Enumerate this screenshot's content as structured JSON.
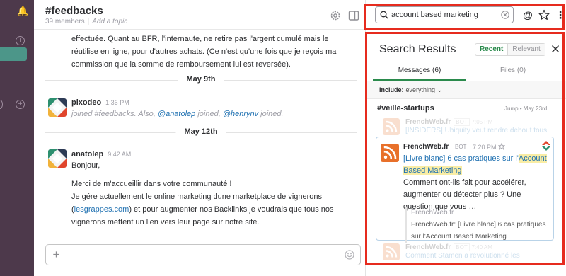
{
  "channel": {
    "name": "#feedbacks",
    "members": "39 members",
    "topic_placeholder": "Add a topic"
  },
  "messages": {
    "continuation": "effectuée. Quant au BFR,  l'internaute,  ne retire pas l'argent cumulé mais le réutilise en ligne, pour d'autres achats. (Ce n'est qu'une fois que je reçois ma commission que la somme de remboursement lui est reversée).",
    "day1": "May 9th",
    "join_msg": {
      "author": "pixodeo",
      "time": "1:36 PM",
      "text_a": "joined #feedbacks. Also, ",
      "mention1": "@anatolep",
      "text_b": " joined, ",
      "mention2": "@henrynv",
      "text_c": " joined."
    },
    "day2": "May 12th",
    "anatole_msg": {
      "author": "anatolep",
      "time": "9:42 AM",
      "line1": "Bonjour,",
      "line2": "Merci de m'accueillir dans votre communauté !",
      "line3": "Je gére actuellement le online marketing dune marketplace de vignerons (",
      "link": "lesgrappes.com",
      "line3b": ") et pour augmenter nos Backlinks je voudrais que tous nos vignerons mettent un lien vers leur page sur notre site."
    }
  },
  "search": {
    "query": "account based marketing"
  },
  "results": {
    "title": "Search Results",
    "sort_recent": "Recent",
    "sort_relevant": "Relevant",
    "tab_messages": "Messages (6)",
    "tab_files": "Files (0)",
    "include_label": "Include:",
    "include_value": "everything ⌄",
    "channel": "#veille-startups",
    "jump": "Jump • May 23rd",
    "faded_top": {
      "author": "FrenchWeb.fr",
      "bot": "BOT",
      "time": "7:05 PM",
      "line": "[INSIDERS] Ubiquity veut rendre debout tous"
    },
    "card": {
      "author": "FrenchWeb.fr",
      "bot": "BOT",
      "time": "7:20 PM",
      "text_link": "[Livre blanc] 6 cas pratiques sur l'",
      "highlight1": "Account",
      "highlight2": "Based Marketing",
      "body": "Comment ont-ils fait pour accélérer, augmenter ou détecter plus ? Une question que vous …",
      "quote_source": "FrenchWeb.fr",
      "quote_text": "FrenchWeb.fr: [Livre blanc] 6 cas pratiques sur l'Account Based Marketing"
    },
    "faded_bottom": {
      "author": "FrenchWeb.fr",
      "bot": "BOT",
      "time": "7:40 AM",
      "line": "Comment Stamen a révolutionné les"
    }
  },
  "colors": {
    "sidebar": "#4d394b",
    "accent_green": "#2a8a4c",
    "link_blue": "#1e70b1",
    "highlight": "#f9eda5",
    "annotation_red": "#e62b1e"
  }
}
